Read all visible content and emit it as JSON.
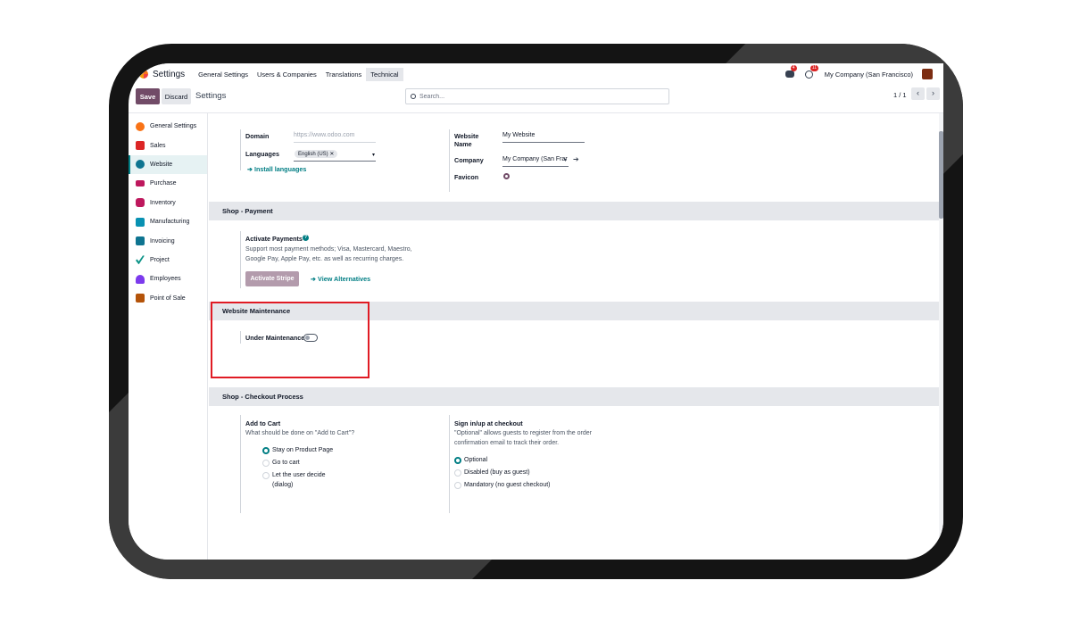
{
  "navbar": {
    "app_name": "Settings",
    "menus": [
      "General Settings",
      "Users & Companies",
      "Translations",
      "Technical"
    ],
    "chat_badge": "4",
    "activity_badge": "11",
    "company": "My Company (San Francisco)"
  },
  "control_panel": {
    "save_label": "Save",
    "discard_label": "Discard",
    "title": "Settings",
    "search_placeholder": "Search...",
    "pager": "1 / 1",
    "prev_icon": "chevron-left-icon",
    "next_icon": "chevron-right-icon"
  },
  "sidebar": {
    "items": [
      {
        "label": "General Settings",
        "icon": "general-settings-icon",
        "color": "#f97316"
      },
      {
        "label": "Sales",
        "icon": "sales-icon",
        "color": "#dc2626"
      },
      {
        "label": "Website",
        "icon": "website-icon",
        "color": "#0e7490"
      },
      {
        "label": "Purchase",
        "icon": "purchase-icon",
        "color": "#be185d"
      },
      {
        "label": "Inventory",
        "icon": "inventory-icon",
        "color": "#be185d"
      },
      {
        "label": "Manufacturing",
        "icon": "manufacturing-icon",
        "color": "#0891b2"
      },
      {
        "label": "Invoicing",
        "icon": "invoicing-icon",
        "color": "#0e7490"
      },
      {
        "label": "Project",
        "icon": "project-icon",
        "color": "#0d9488"
      },
      {
        "label": "Employees",
        "icon": "employees-icon",
        "color": "#7c3aed"
      },
      {
        "label": "Point of Sale",
        "icon": "point-of-sale-icon",
        "color": "#b45309"
      }
    ],
    "active": "Website"
  },
  "website_block": {
    "domain_label": "Domain",
    "domain_placeholder": "https://www.odoo.com",
    "languages_label": "Languages",
    "language_tag": "English (US)",
    "install_languages": "Install languages",
    "website_name_label_1": "Website",
    "website_name_label_2": "Name",
    "website_name_value": "My Website",
    "company_label": "Company",
    "company_value": "My Company (San Frar",
    "favicon_label": "Favicon"
  },
  "shop_payment": {
    "title": "Shop - Payment",
    "activate_label": "Activate Payments",
    "description_1": "Support most payment methods; Visa, Mastercard, Maestro,",
    "description_2": "Google Pay, Apple Pay, etc. as well as recurring charges.",
    "activate_stripe": "Activate Stripe",
    "view_alternatives": "View Alternatives"
  },
  "website_maintenance": {
    "title": "Website Maintenance",
    "under_maintenance_label": "Under Maintenance",
    "under_maintenance_enabled": false
  },
  "checkout": {
    "title": "Shop - Checkout Process",
    "add_to_cart_label": "Add to Cart",
    "add_to_cart_desc": "What should be done on \"Add to Cart\"?",
    "add_to_cart_options": [
      "Stay on Product Page",
      "Go to cart",
      "Let the user decide",
      "(dialog)"
    ],
    "add_to_cart_selected": "Stay on Product Page",
    "sign_in_label": "Sign in/up at checkout",
    "sign_in_desc_1": "\"Optional\" allows guests to register from the order",
    "sign_in_desc_2": "confirmation email to track their order.",
    "sign_in_options": [
      "Optional",
      "Disabled (buy as guest)",
      "Mandatory (no guest checkout)"
    ],
    "sign_in_selected": "Optional"
  },
  "colors": {
    "brand": "#714b67",
    "accent": "#017e84",
    "highlight_box": "#e01b24"
  }
}
